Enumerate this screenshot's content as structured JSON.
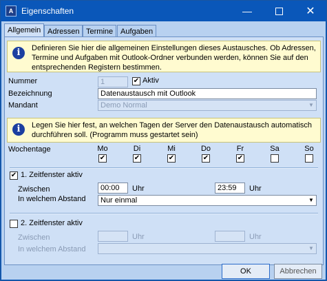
{
  "window": {
    "title": "Eigenschaften",
    "app_icon_letter": "A"
  },
  "tabs": [
    {
      "label": "Allgemein"
    },
    {
      "label": "Adressen"
    },
    {
      "label": "Termine"
    },
    {
      "label": "Aufgaben"
    }
  ],
  "info1": {
    "text": "Definieren Sie hier die allgemeinen Einstellungen dieses Austausches. Ob Adressen, Termine und Aufgaben mit Outlook-Ordner verbunden werden, können Sie auf den entsprechenden Registern bestimmen."
  },
  "form": {
    "nummer_label": "Nummer",
    "nummer_value": "1",
    "aktiv_label": "Aktiv",
    "aktiv_checked": true,
    "bezeichnung_label": "Bezeichnung",
    "bezeichnung_value": "Datenaustausch mit Outlook",
    "mandant_label": "Mandant",
    "mandant_value": "Demo Normal"
  },
  "info2": {
    "text": "Legen Sie hier fest, an welchen Tagen der Server den Datenaustausch automatisch durchführen soll. (Programm muss gestartet sein)"
  },
  "wochentage": {
    "label": "Wochentage",
    "days": [
      {
        "name": "Mo",
        "checked": true
      },
      {
        "name": "Di",
        "checked": true
      },
      {
        "name": "Mi",
        "checked": true
      },
      {
        "name": "Do",
        "checked": true
      },
      {
        "name": "Fr",
        "checked": true
      },
      {
        "name": "Sa",
        "checked": false
      },
      {
        "name": "So",
        "checked": false
      }
    ]
  },
  "zeitfenster1": {
    "label": "1. Zeitfenster aktiv",
    "checked": true,
    "zwischen_label": "Zwischen",
    "from": "00:00",
    "to": "23:59",
    "uhr": "Uhr",
    "abstand_label": "In welchem Abstand",
    "abstand_value": "Nur einmal"
  },
  "zeitfenster2": {
    "label": "2. Zeitfenster aktiv",
    "checked": false,
    "zwischen_label": "Zwischen",
    "from": "",
    "to": "",
    "uhr": "Uhr",
    "abstand_label": "In welchem Abstand",
    "abstand_value": ""
  },
  "buttons": {
    "ok": "OK",
    "cancel": "Abbrechen"
  },
  "icons": {
    "minimize": "minimize-icon",
    "maximize": "maximize-icon",
    "close": "close-icon",
    "info": "info-icon",
    "dropdown": "chevron-down-icon",
    "check": "checkmark-icon"
  }
}
